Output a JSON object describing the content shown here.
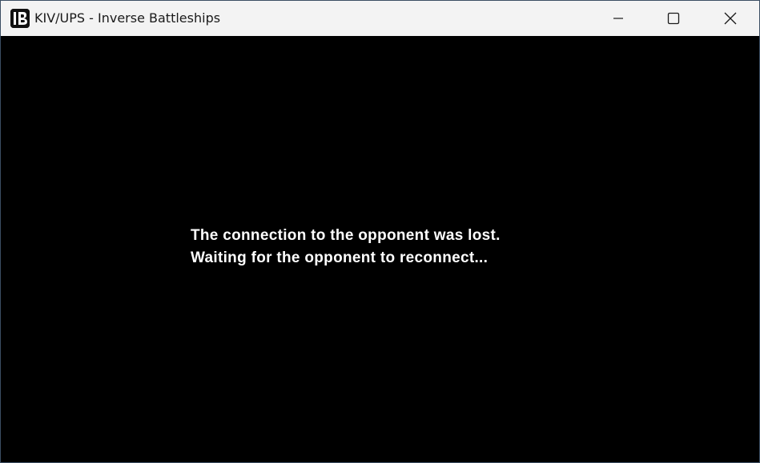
{
  "window": {
    "title": "KIV/UPS - Inverse Battleships",
    "icon": "app-logo-icon",
    "caption_buttons": [
      "minimize-icon",
      "maximize-icon",
      "close-icon"
    ]
  },
  "content": {
    "background": "#000000",
    "text_color": "#ffffff",
    "message_line_1": "The connection to the opponent was lost.",
    "message_line_2": "Waiting for the opponent to reconnect..."
  }
}
